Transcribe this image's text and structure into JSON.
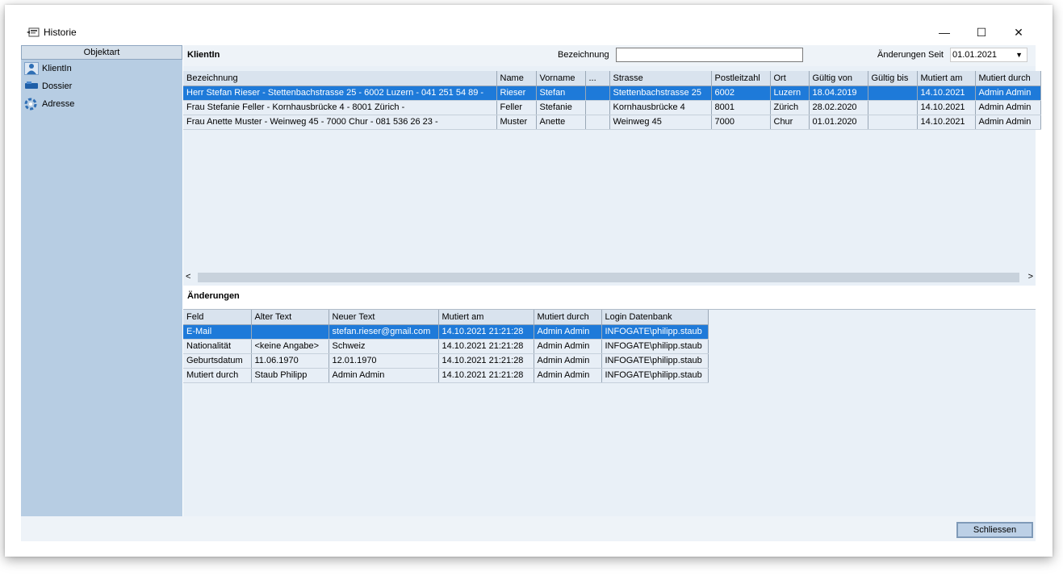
{
  "window": {
    "title": "Historie",
    "min_glyph": "—",
    "max_glyph": "☐",
    "close_glyph": "✕"
  },
  "sidebar": {
    "header": "Objektart",
    "items": [
      {
        "label": "KlientIn",
        "icon": "person-icon"
      },
      {
        "label": "Dossier",
        "icon": "folder-icon"
      },
      {
        "label": "Adresse",
        "icon": "lifebuoy-icon"
      }
    ]
  },
  "top": {
    "section_title": "KlientIn",
    "bezeichnung_label": "Bezeichnung",
    "bezeichnung_value": "",
    "aenderungen_label": "Änderungen Seit",
    "aenderungen_value": "01.01.2021",
    "dropdown_arrow": "▼"
  },
  "clients": {
    "headers": [
      "Bezeichnung",
      "Name",
      "Vorname",
      "...",
      "Strasse",
      "Postleitzahl",
      "Ort",
      "Gültig von",
      "Gültig bis",
      "Mutiert am",
      "Mutiert durch"
    ],
    "rows": [
      [
        "Herr Stefan Rieser -  Stettenbachstrasse 25 -  6002 Luzern -  041 251 54 89 -",
        "Rieser",
        "Stefan",
        "",
        "Stettenbachstrasse 25",
        "6002",
        "Luzern",
        "18.04.2019",
        "",
        "14.10.2021",
        "Admin Admin"
      ],
      [
        "Frau Stefanie Feller -  Kornhausbrücke 4 -  8001 Zürich -",
        "Feller",
        "Stefanie",
        "",
        "Kornhausbrücke 4",
        "8001",
        "Zürich",
        "28.02.2020",
        "",
        "14.10.2021",
        "Admin Admin"
      ],
      [
        "Frau Anette Muster -  Weinweg 45 -  7000 Chur -  081 536 26 23 -",
        "Muster",
        "Anette",
        "",
        "Weinweg 45",
        "7000",
        "Chur",
        "01.01.2020",
        "",
        "14.10.2021",
        "Admin Admin"
      ]
    ],
    "selected_row": 0
  },
  "scroll": {
    "left": "<",
    "right": ">"
  },
  "changes": {
    "section_title": "Änderungen",
    "headers": [
      "Feld",
      "Alter Text",
      "Neuer Text",
      "Mutiert am",
      "Mutiert durch",
      "Login Datenbank"
    ],
    "rows": [
      [
        "E-Mail",
        "",
        "stefan.rieser@gmail.com",
        "14.10.2021 21:21:28",
        "Admin Admin",
        "INFOGATE\\philipp.staub"
      ],
      [
        "Nationalität",
        "<keine Angabe>",
        "Schweiz",
        "14.10.2021 21:21:28",
        "Admin Admin",
        "INFOGATE\\philipp.staub"
      ],
      [
        "Geburtsdatum",
        "11.06.1970",
        "12.01.1970",
        "14.10.2021 21:21:28",
        "Admin Admin",
        "INFOGATE\\philipp.staub"
      ],
      [
        "Mutiert durch",
        "Staub Philipp",
        "Admin Admin",
        "14.10.2021 21:21:28",
        "Admin Admin",
        "INFOGATE\\philipp.staub"
      ]
    ],
    "selected_row": 0
  },
  "footer": {
    "close_label": "Schliessen"
  },
  "colors": {
    "selection": "#1e7ad9",
    "sidebar": "#b7cde3",
    "grid_bg": "#e7eef6"
  }
}
